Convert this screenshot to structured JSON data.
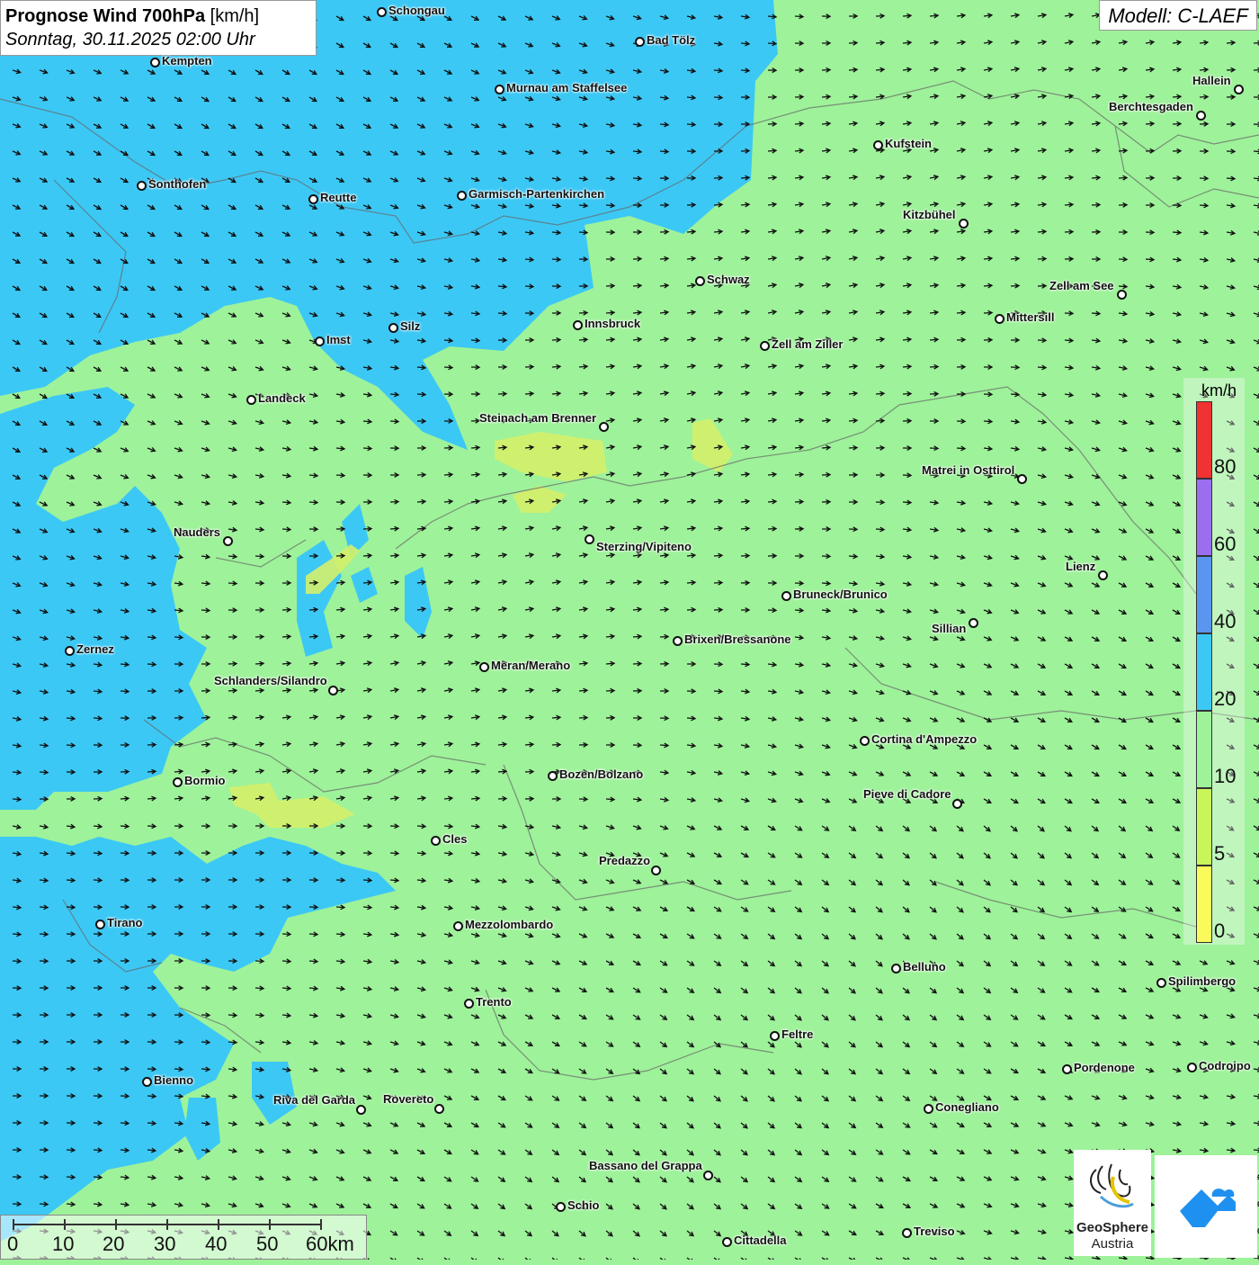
{
  "header": {
    "title_bold": "Prognose Wind 700hPa",
    "title_unit": "[km/h]",
    "subtitle": "Sonntag, 30.11.2025 02:00 Uhr",
    "model": "Modell: C-LAEF"
  },
  "legend": {
    "unit": "km/h",
    "stops": [
      {
        "label": "0",
        "color": "#fafa5a"
      },
      {
        "label": "5",
        "color": "#c8f55a"
      },
      {
        "label": "10",
        "color": "#9ef29a"
      },
      {
        "label": "20",
        "color": "#3cc8f5"
      },
      {
        "label": "40",
        "color": "#5a96f0"
      },
      {
        "label": "60",
        "color": "#9b6ef0"
      },
      {
        "label": "80",
        "color": "#f03232"
      }
    ]
  },
  "scale_bar": {
    "labels": [
      "0",
      "10",
      "20",
      "30",
      "40",
      "50",
      "60km"
    ]
  },
  "branding": {
    "geosphere_line1": "GeoSphere",
    "geosphere_line2": "Austria"
  },
  "cities": [
    {
      "name": "Schongau"
    },
    {
      "name": "Bad Tölz"
    },
    {
      "name": "Kempten"
    },
    {
      "name": "Murnau am Staffelsee"
    },
    {
      "name": "Hallein"
    },
    {
      "name": "Berchtesgaden"
    },
    {
      "name": "Kufstein"
    },
    {
      "name": "Sonthofen"
    },
    {
      "name": "Reutte"
    },
    {
      "name": "Garmisch-Partenkirchen"
    },
    {
      "name": "Kitzbühel"
    },
    {
      "name": "Schwaz"
    },
    {
      "name": "Zell am See"
    },
    {
      "name": "Mittersill"
    },
    {
      "name": "Innsbruck"
    },
    {
      "name": "Silz"
    },
    {
      "name": "Imst"
    },
    {
      "name": "Zell am Ziller"
    },
    {
      "name": "Landeck"
    },
    {
      "name": "Steinach am Brenner"
    },
    {
      "name": "Matrei in Osttirol"
    },
    {
      "name": "Nauders"
    },
    {
      "name": "Sterzing/Vipiteno"
    },
    {
      "name": "Lienz"
    },
    {
      "name": "Bruneck/Brunico"
    },
    {
      "name": "Sillian"
    },
    {
      "name": "Brixen/Bressanone"
    },
    {
      "name": "Zernez"
    },
    {
      "name": "Meran/Merano"
    },
    {
      "name": "Schlanders/Silandro"
    },
    {
      "name": "Cortina d'Ampezzo"
    },
    {
      "name": "Bozen/Bolzano"
    },
    {
      "name": "Bormio"
    },
    {
      "name": "Pieve di Cadore"
    },
    {
      "name": "Cles"
    },
    {
      "name": "Predazzo"
    },
    {
      "name": "Tirano"
    },
    {
      "name": "Mezzolombardo"
    },
    {
      "name": "Belluno"
    },
    {
      "name": "Spilimbergo"
    },
    {
      "name": "Trento"
    },
    {
      "name": "Feltre"
    },
    {
      "name": "Bienno"
    },
    {
      "name": "Pordenone"
    },
    {
      "name": "Codroipo"
    },
    {
      "name": "Riva del Garda"
    },
    {
      "name": "Rovereto"
    },
    {
      "name": "Conegliano"
    },
    {
      "name": "Bassano del Grappa"
    },
    {
      "name": "Schio"
    },
    {
      "name": "Treviso"
    },
    {
      "name": "Cittadella"
    }
  ]
}
